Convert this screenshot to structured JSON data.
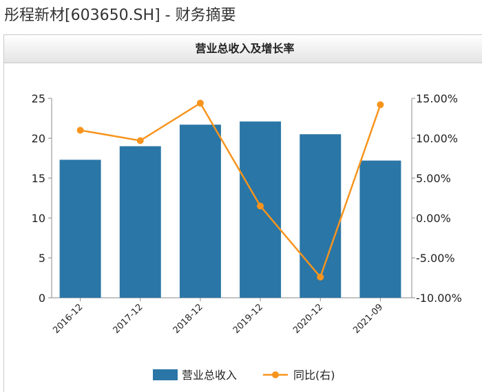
{
  "page": {
    "title": "彤程新材[603650.SH] - 财务摘要"
  },
  "chart_data": {
    "type": "bar",
    "title": "营业总收入及增长率",
    "categories": [
      "2016-12",
      "2017-12",
      "2018-12",
      "2019-12",
      "2020-12",
      "2021-09"
    ],
    "series": [
      {
        "name": "营业总收入",
        "type": "bar",
        "axis": "left",
        "color": "#2a76a6",
        "values": [
          17.3,
          19.0,
          21.7,
          22.1,
          20.5,
          17.2
        ]
      },
      {
        "name": "同比(右)",
        "type": "line",
        "axis": "right",
        "color": "#f7941d",
        "values": [
          11.0,
          9.7,
          14.4,
          1.5,
          -7.4,
          14.2
        ]
      }
    ],
    "ylim_left": [
      0,
      25
    ],
    "ylim_right": [
      -10,
      15
    ],
    "yticks_left": [
      "0",
      "5",
      "10",
      "15",
      "20",
      "25"
    ],
    "yticks_right": [
      "-10.00%",
      "-5.00%",
      "0.00%",
      "5.00%",
      "10.00%",
      "15.00%"
    ],
    "grid": false,
    "legend_position": "bottom"
  }
}
